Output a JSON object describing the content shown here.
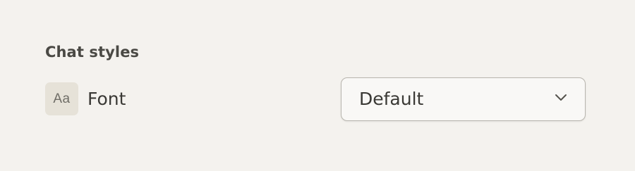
{
  "section": {
    "title": "Chat styles"
  },
  "font_setting": {
    "icon_glyph": "Aa",
    "icon": "font-icon",
    "label": "Font",
    "select": {
      "value": "Default",
      "icon": "chevron-down-icon"
    }
  }
}
